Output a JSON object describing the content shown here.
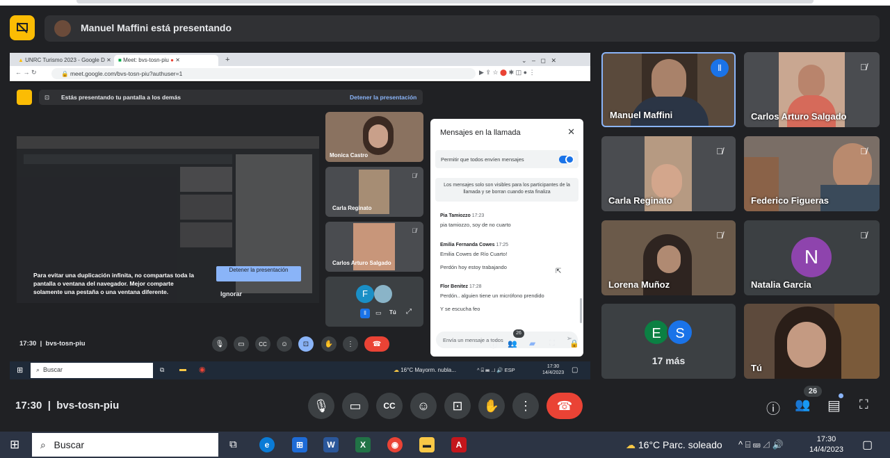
{
  "presenter_banner": {
    "text": "Manuel Maffini está presentando"
  },
  "shared_screen": {
    "tabs": [
      {
        "label": "UNRC Turismo 2023 - Google D"
      },
      {
        "label": "Meet: bvs-tosn-piu"
      }
    ],
    "url": "meet.google.com/bvs-tosn-piu?authuser=1",
    "inner_banner": {
      "text": "Estás presentando tu pantalla a los demás",
      "stop_label": "Detener la presentación"
    },
    "warning": {
      "text": "Para evitar una duplicación infinita, no compartas toda la pantalla o ventana del navegador. Mejor comparte solamente una pestaña o una ventana diferente.",
      "stop_button": "Detener la presentación",
      "ignore_button": "Ignorar"
    },
    "tiles": [
      {
        "name": "Monica Castro"
      },
      {
        "name": "Carla Reginato"
      },
      {
        "name": "Carlos Arturo Salgado"
      },
      {
        "initial": "F",
        "self_label": "Tú"
      }
    ],
    "chat": {
      "title": "Mensajes en la llamada",
      "toggle_label": "Permitir que todos envíen mensajes",
      "notice": "Los mensajes solo son visibles para los participantes de la llamada y se borran cuando esta finaliza",
      "messages": [
        {
          "sender": "Pia Tamiozzo",
          "time": "17:23",
          "lines": [
            "pia tamiozzo, soy de no cuarto"
          ]
        },
        {
          "sender": "Emilia Fernanda Cowes",
          "time": "17:25",
          "lines": [
            "Emilia Cowes  de Río Cuarto!",
            "Perdón  hoy estoy trabajando"
          ]
        },
        {
          "sender": "Flor Benitez",
          "time": "17:28",
          "lines": [
            "Perdón..  alguien tiene un micrófono prendido",
            "Y se escucha feo"
          ]
        }
      ],
      "input_placeholder": "Envía un mensaje a todos"
    },
    "bottom": {
      "time": "17:30",
      "meeting_code": "bvs-tosn-piu",
      "people_count": "26"
    },
    "taskbar": {
      "search": "Buscar",
      "weather": "16°C  Mayorm. nubla...",
      "lang": "ESP",
      "time": "17:30",
      "date": "14/4/2023"
    }
  },
  "participants": [
    {
      "name": "Manuel Maffini",
      "speaking": true
    },
    {
      "name": "Carlos Arturo Salgado"
    },
    {
      "name": "Carla Reginato"
    },
    {
      "name": "Federico Figueras"
    },
    {
      "name": "Lorena Muñoz"
    },
    {
      "name": "Natalia Garcia",
      "initial": "N"
    },
    {
      "more_label": "17 más",
      "initials": [
        "E",
        "S"
      ]
    },
    {
      "name": "Tú"
    }
  ],
  "bottom_bar": {
    "time": "17:30",
    "meeting_code": "bvs-tosn-piu",
    "people_count": "26"
  },
  "taskbar": {
    "search": "Buscar",
    "weather": "16°C  Parc. soleado",
    "time": "17:30",
    "date": "14/4/2023"
  },
  "colors": {
    "end_call": "#ea4335",
    "present_active": "#8ab4f8",
    "natalia_avatar": "#8e44ad",
    "banner_icon": "#fbbc04"
  }
}
